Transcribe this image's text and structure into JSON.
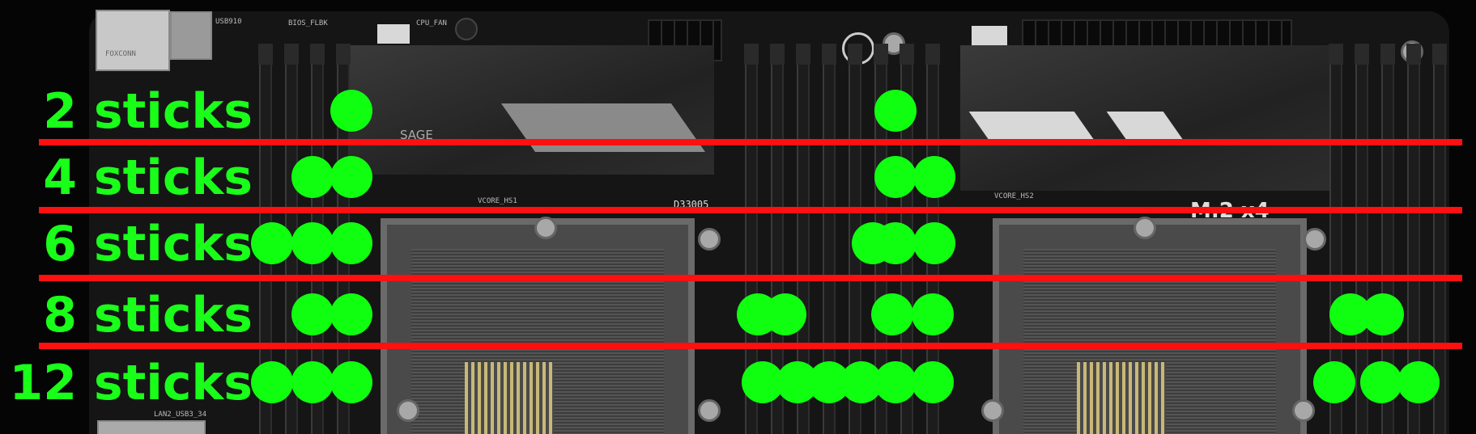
{
  "board_silkscreen": {
    "usb": "USB910",
    "bios_flbk": "BIOS_FLBK",
    "cpu_fan": "CPU_FAN",
    "heatsink_brand": "SAGE",
    "port_brand": "FOXCONN",
    "vcore_hs1": "VCORE_HS1",
    "vcore_hs2": "VCORE_HS2",
    "part_code": "D33005",
    "lan_usb": "LAN2_USB3_34",
    "m2_label": "M.2 x4"
  },
  "rows": [
    {
      "label": "2 sticks",
      "slots": [
        3,
        10
      ]
    },
    {
      "label": "4 sticks",
      "slots": [
        2,
        3,
        10,
        11
      ]
    },
    {
      "label": "6 sticks",
      "slots": [
        1,
        2,
        3,
        9,
        10,
        11
      ]
    },
    {
      "label": "8 sticks",
      "slots": [
        2,
        3,
        7,
        8,
        10,
        11,
        17,
        18
      ]
    },
    {
      "label": "12 sticks",
      "slots": [
        1,
        2,
        3,
        6,
        7,
        8,
        9,
        10,
        11,
        16,
        17,
        18
      ]
    }
  ],
  "colors": {
    "label": "#19ff19",
    "dot": "#10ff10",
    "divider": "#ff1010",
    "board": "#151515"
  }
}
